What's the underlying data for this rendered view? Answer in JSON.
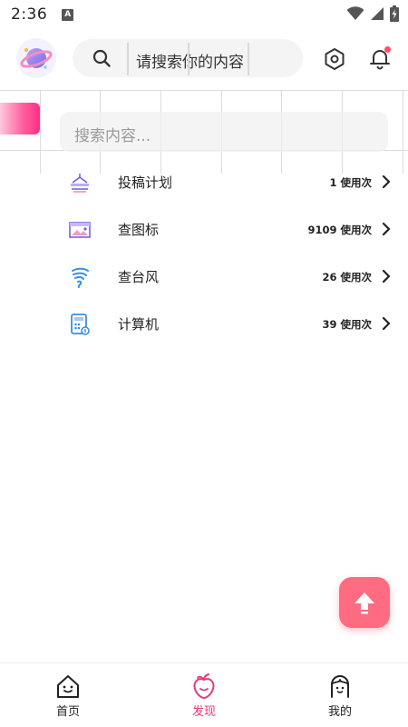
{
  "status_bar": {
    "time": "2:36",
    "notification_icon": "a-badge-icon",
    "icons": [
      "wifi-icon",
      "signal-icon",
      "battery-charging-icon"
    ]
  },
  "header": {
    "avatar_icon": "planet-avatar-icon",
    "search_placeholder": "请搜索你的内容",
    "search_icon": "search-icon",
    "settings_icon": "hexagon-settings-icon",
    "bell_icon": "bell-icon"
  },
  "search2": {
    "placeholder": "搜索内容..."
  },
  "tools": [
    {
      "title": "投稿计划",
      "count": "1 使用次",
      "icon": "submission-plan-icon"
    },
    {
      "title": "查图标",
      "count": "9109 使用次",
      "icon": "image-search-icon"
    },
    {
      "title": "查台风",
      "count": "26 使用次",
      "icon": "typhoon-icon"
    },
    {
      "title": "计算机",
      "count": "39 使用次",
      "icon": "calculator-icon"
    }
  ],
  "fab": {
    "icon": "arrow-up-icon"
  },
  "bottom_nav": [
    {
      "label": "首页",
      "icon": "home-icon",
      "active": false
    },
    {
      "label": "发现",
      "icon": "peach-discover-icon",
      "active": true
    },
    {
      "label": "我的",
      "icon": "profile-icon",
      "active": false
    }
  ],
  "colors": {
    "accent_pink": "#e8387d",
    "fab": "#ff6b81",
    "notification_dot": "#ff4f66"
  }
}
